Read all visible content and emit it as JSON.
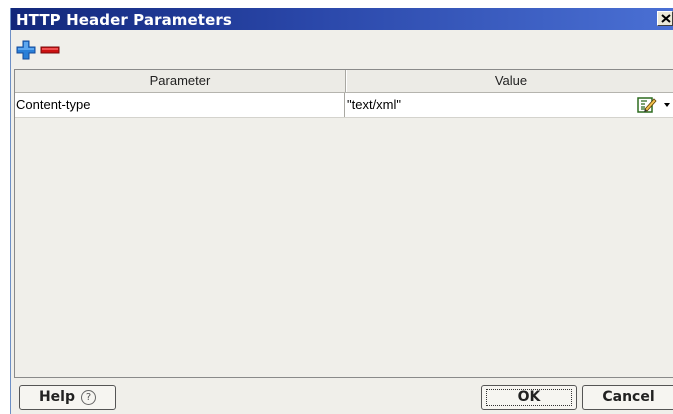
{
  "window": {
    "title": "HTTP Header Parameters",
    "close_glyph": "✕"
  },
  "toolbar": {
    "add_icon": "plus-icon",
    "remove_icon": "minus-icon",
    "add_color": "#2a7fd8",
    "remove_color": "#cc1111"
  },
  "grid": {
    "columns": [
      "Parameter",
      "Value"
    ],
    "rows": [
      {
        "parameter": "Content-type",
        "value": "\"text/xml\""
      }
    ]
  },
  "buttons": {
    "help_label": "Help",
    "help_glyph": "?",
    "ok_label": "OK",
    "cancel_label": "Cancel"
  }
}
